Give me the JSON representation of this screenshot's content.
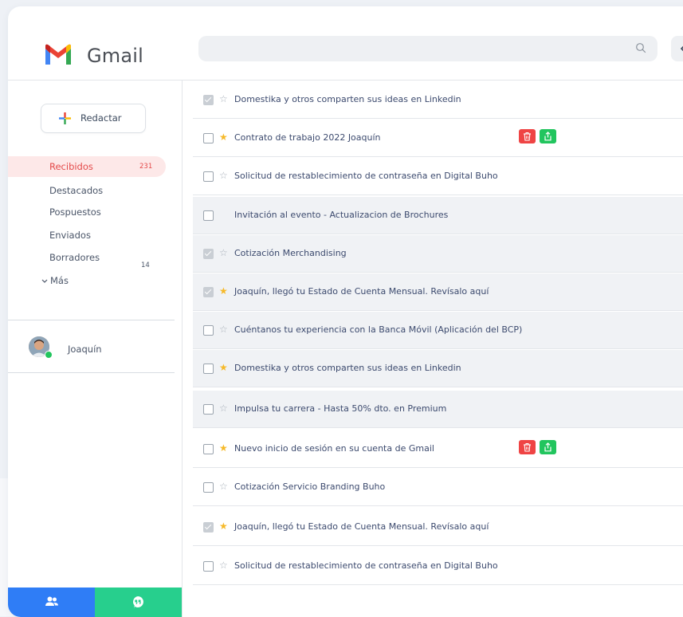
{
  "app": {
    "name": "Gmail"
  },
  "search": {
    "placeholder": ""
  },
  "colors": {
    "accent": "#e44b4b",
    "star": "#f6b928",
    "delete": "#ef4444",
    "share": "#22c55e",
    "footer_left": "#2f7df6",
    "footer_right": "#27cf8d"
  },
  "compose": {
    "label": "Redactar"
  },
  "nav": [
    {
      "label": "Recibidos",
      "count": "231",
      "active": true
    },
    {
      "label": "Destacados",
      "count": ""
    },
    {
      "label": "Pospuestos",
      "count": ""
    },
    {
      "label": "Enviados",
      "count": ""
    },
    {
      "label": "Borradores",
      "count": "14"
    }
  ],
  "more": {
    "label": "Más"
  },
  "user": {
    "name": "Joaquín"
  },
  "footer": {
    "left_icon": "users-icon",
    "right_icon": "chat-quote-icon"
  },
  "emails": [
    {
      "subject": "Domestika y otros comparten sus ideas en Linkedin",
      "checked": true,
      "starred": false,
      "shaded": false,
      "actions": false
    },
    {
      "subject": "Contrato de trabajo 2022 Joaquín",
      "checked": false,
      "starred": true,
      "shaded": false,
      "actions": true
    },
    {
      "subject": "Solicitud de restablecimiento de contraseña en Digital Buho",
      "checked": false,
      "starred": false,
      "shaded": false,
      "actions": false
    },
    {
      "subject": "Invitación al evento - Actualizacion de Brochures",
      "checked": false,
      "starred": null,
      "shaded": true,
      "actions": false
    },
    {
      "subject": "Cotización Merchandising",
      "checked": true,
      "starred": false,
      "shaded": true,
      "actions": false
    },
    {
      "subject": "Joaquín, llegó tu Estado de Cuenta Mensual. Revísalo aquí",
      "checked": true,
      "starred": true,
      "shaded": true,
      "actions": false
    },
    {
      "subject": "Cuéntanos tu experiencia con la Banca Móvil (Aplicación del BCP)",
      "checked": false,
      "starred": false,
      "shaded": true,
      "actions": false
    },
    {
      "subject": "Domestika y otros comparten sus ideas en Linkedin",
      "checked": false,
      "starred": true,
      "shaded": true,
      "actions": false
    },
    {
      "subject": "Impulsa tu carrera - Hasta 50% dto. en Premium",
      "checked": false,
      "starred": false,
      "shaded": true,
      "actions": false
    },
    {
      "subject": "Nuevo inicio de sesión en su cuenta de Gmail",
      "checked": false,
      "starred": true,
      "shaded": false,
      "actions": true
    },
    {
      "subject": "Cotización Servicio Branding Buho",
      "checked": false,
      "starred": false,
      "shaded": false,
      "actions": false
    },
    {
      "subject": "Joaquín, llegó tu Estado de Cuenta Mensual. Revísalo aquí",
      "checked": true,
      "starred": true,
      "shaded": false,
      "actions": false
    },
    {
      "subject": "Solicitud de restablecimiento de contraseña en Digital Buho",
      "checked": false,
      "starred": false,
      "shaded": false,
      "actions": false
    }
  ]
}
